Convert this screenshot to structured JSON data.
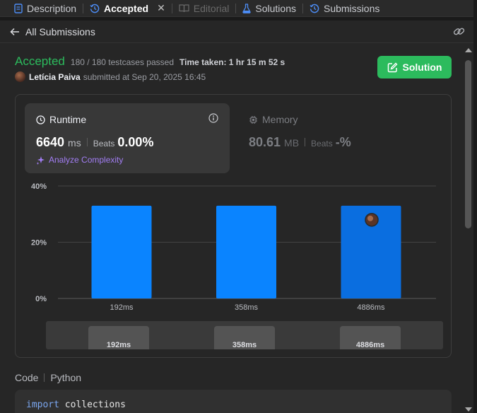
{
  "tabs": [
    {
      "label": "Description",
      "icon": "description-icon",
      "state": "normal"
    },
    {
      "label": "Accepted",
      "icon": "history-icon",
      "state": "active"
    },
    {
      "label": "Editorial",
      "icon": "book-icon",
      "state": "disabled"
    },
    {
      "label": "Solutions",
      "icon": "flask-icon",
      "state": "normal"
    },
    {
      "label": "Submissions",
      "icon": "history-icon",
      "state": "normal"
    }
  ],
  "nav": {
    "back_label": "All Submissions"
  },
  "submission": {
    "status": "Accepted",
    "testcases": "180 / 180 testcases passed",
    "time_taken": "Time taken: 1 hr 15 m 52 s",
    "username": "Letícia Paiva",
    "submitted_at": "submitted at Sep 20, 2025 16:45"
  },
  "solution_button": {
    "label": "Solution"
  },
  "runtime": {
    "title": "Runtime",
    "value": "6640",
    "unit": "ms",
    "beats_label": "Beats",
    "beats_value": "0.00%",
    "analyze_label": "Analyze Complexity"
  },
  "memory": {
    "title": "Memory",
    "value": "80.61",
    "unit": "MB",
    "beats_label": "Beats",
    "beats_value": "-%"
  },
  "chart_data": {
    "type": "bar",
    "categories": [
      "192ms",
      "358ms",
      "4886ms"
    ],
    "values": [
      33,
      33,
      33
    ],
    "ylim": [
      0,
      40
    ],
    "y_ticks": [
      "0%",
      "20%",
      "40%"
    ],
    "y_tick_values": [
      0,
      20,
      40
    ],
    "highlight_index": 2,
    "bar_color": "#0a84ff",
    "highlight_color": "#0a6ee0",
    "grid": true
  },
  "range_navigator": {
    "labels": [
      "192ms",
      "358ms",
      "4886ms"
    ]
  },
  "code": {
    "label": "Code",
    "language": "Python",
    "first_line_keyword": "import",
    "first_line_rest": "collections"
  },
  "colors": {
    "accent_green": "#2cbb5d",
    "analyze_purple": "#a17df2",
    "bar_blue": "#0a84ff"
  }
}
